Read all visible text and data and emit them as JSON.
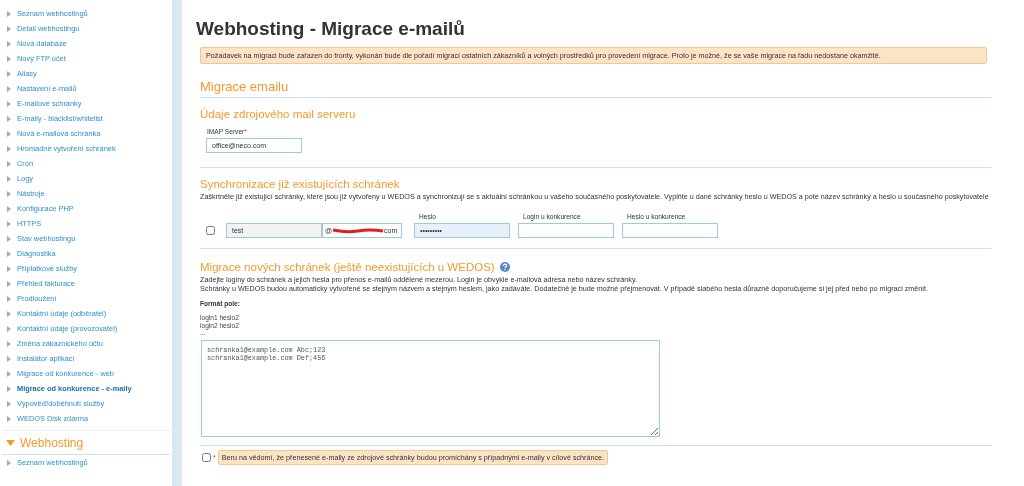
{
  "sidebar": {
    "items": [
      {
        "label": "Seznam webhostingů",
        "selected": false
      },
      {
        "label": "Detail webhostingu",
        "selected": false
      },
      {
        "label": "Nová databáze",
        "selected": false
      },
      {
        "label": "Nový FTP účet",
        "selected": false
      },
      {
        "label": "Aliasy",
        "selected": false
      },
      {
        "label": "Nastavení e-mailů",
        "selected": false
      },
      {
        "label": "E-mailové schránky",
        "selected": false
      },
      {
        "label": "E-maily - blacklist/whitelist",
        "selected": false
      },
      {
        "label": "Nová e-mailová schránka",
        "selected": false
      },
      {
        "label": "Hromadné vytvoření schránek",
        "selected": false
      },
      {
        "label": "Cron",
        "selected": false
      },
      {
        "label": "Logy",
        "selected": false
      },
      {
        "label": "Nástroje",
        "selected": false
      },
      {
        "label": "Konfigurace PHP",
        "selected": false
      },
      {
        "label": "HTTPS",
        "selected": false
      },
      {
        "label": "Stav webhostingu",
        "selected": false
      },
      {
        "label": "Diagnostika",
        "selected": false
      },
      {
        "label": "Příplatkové služby",
        "selected": false
      },
      {
        "label": "Přehled fakturace",
        "selected": false
      },
      {
        "label": "Prodloužení",
        "selected": false
      },
      {
        "label": "Kontaktní údaje (odběratel)",
        "selected": false
      },
      {
        "label": "Kontaktní údaje (provozovatel)",
        "selected": false
      },
      {
        "label": "Změna zákaznického účtu",
        "selected": false
      },
      {
        "label": "Instalátor aplikací",
        "selected": false
      },
      {
        "label": "Migrace od konkurence - web",
        "selected": false
      },
      {
        "label": "Migrace od konkurence - e-maily",
        "selected": true
      },
      {
        "label": "Výpověď/doběhnutí služby",
        "selected": false
      },
      {
        "label": "WEDOS Disk zdarma",
        "selected": false
      }
    ],
    "section": {
      "title": "Webhosting",
      "expanded": true,
      "items": [
        {
          "label": "Seznam webhostingů",
          "selected": false
        }
      ]
    }
  },
  "page": {
    "title": "Webhosting - Migrace e-mailů",
    "notice": "Požadavek na migraci bude zařazen do fronty, vykonán bude dle pořadí migrací ostatních zákazníků a volných prostředků pro provedení migrace. Proto je možné, že se vaše migrace na řadu nedostane okamžitě.",
    "section_title": "Migrace emailu",
    "source": {
      "title": "Údaje zdrojového mail serveru",
      "label": "IMAP Server",
      "required": true,
      "required_mark": "*",
      "value": "office@neco.com"
    },
    "sync": {
      "title": "Synchronizace již existujících schránek",
      "description": "Zaškrtněte již existující schránky, které jsou již vytvořeny u WEDOS a synchronizují se s aktuální schránkou u vašeho současného poskytovatele. Vyplňte u dané schránky heslo u WEDOS a poté název schránky a heslo u současného poskytovatele",
      "columns": [
        "Heslo",
        "Login u konkurence",
        "Heslo u konkurence"
      ],
      "rows": [
        {
          "checked": false,
          "mailbox": "test",
          "at": "@",
          "domain_end": "com",
          "password": "•••••••••",
          "login": "",
          "competitor_password": ""
        }
      ]
    },
    "new": {
      "title": "Migrace nových schránek (ještě neexistujících u WEDOS)",
      "description": [
        "Zadejte loginy do schránek a jejich hesla pro přenos e-mailů oddělené mezerou. Login je obvykle e-mailová adresa nebo název schránky.",
        "Schránky u WEDOS budou automaticky vytvořené se stejným názvem a stejným heslem, jako zadáváte. Dodatečně je bude možné přejmenovat. V případě slabého hesla důrazně doporučujeme si jej před nebo po migraci změnit."
      ],
      "format_label": "Formát pole:",
      "format_lines": [
        "login1 heslo2",
        "login2 heslo2",
        "..."
      ],
      "textarea": "schranka1@example.com Abc;123\nschranka1@example.com Def;456"
    },
    "consent": {
      "checked": false,
      "required": true,
      "required_mark": "*",
      "text": "Beru na vědomí, že přenesené e-maily ze zdrojové schránky budou promíchány s případnými e-maily v cílové schránce."
    }
  }
}
